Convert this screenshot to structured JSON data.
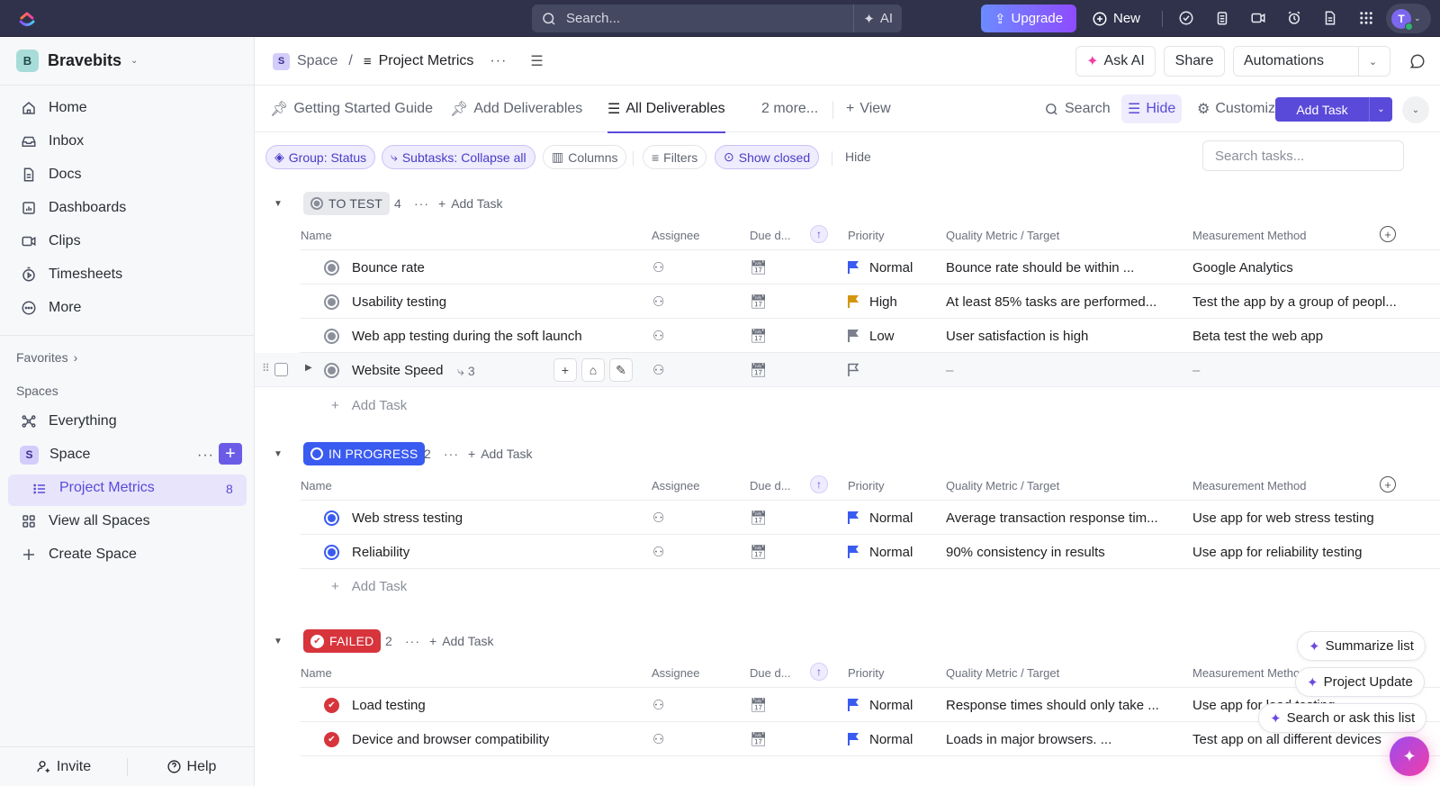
{
  "topbar": {
    "search_placeholder": "Search...",
    "ai_label": "AI",
    "upgrade_label": "Upgrade",
    "new_label": "New",
    "icons": [
      "check-circle-icon",
      "clipboard-icon",
      "video-icon",
      "alarm-clock-icon",
      "document-icon",
      "apps-grid-icon"
    ],
    "avatar_initial": "T"
  },
  "sidebar": {
    "workspace": {
      "initial": "B",
      "name": "Bravebits"
    },
    "nav": [
      {
        "label": "Home",
        "icon": "home-icon"
      },
      {
        "label": "Inbox",
        "icon": "inbox-icon"
      },
      {
        "label": "Docs",
        "icon": "docs-icon"
      },
      {
        "label": "Dashboards",
        "icon": "dashboards-icon"
      },
      {
        "label": "Clips",
        "icon": "clips-icon"
      },
      {
        "label": "Timesheets",
        "icon": "timesheets-icon"
      },
      {
        "label": "More",
        "icon": "more-icon"
      }
    ],
    "favorites_label": "Favorites",
    "spaces_label": "Spaces",
    "everything_label": "Everything",
    "space": {
      "initial": "S",
      "name": "Space"
    },
    "active_list": {
      "label": "Project Metrics",
      "count": "8"
    },
    "view_all_label": "View all Spaces",
    "create_label": "Create Space",
    "invite_label": "Invite",
    "help_label": "Help"
  },
  "header": {
    "breadcrumb": {
      "space_initial": "S",
      "space": "Space",
      "separator": "/",
      "list": "Project Metrics"
    },
    "ask_ai": "Ask AI",
    "share": "Share",
    "automations": "Automations"
  },
  "views": {
    "tabs": [
      {
        "label": "Getting Started Guide",
        "active": false
      },
      {
        "label": "Add Deliverables",
        "active": false
      },
      {
        "label": "All Deliverables",
        "active": true
      },
      {
        "label": "2 more...",
        "active": false
      }
    ],
    "add_view": "View",
    "search": "Search",
    "hide": "Hide",
    "customize": "Customize",
    "add_task": "Add Task"
  },
  "filters": {
    "group": "Group: Status",
    "subtasks": "Subtasks: Collapse all",
    "columns": "Columns",
    "filters": "Filters",
    "show_closed": "Show closed",
    "hide": "Hide",
    "search_placeholder": "Search tasks..."
  },
  "columns": {
    "name": "Name",
    "assignee": "Assignee",
    "due": "Due d...",
    "priority": "Priority",
    "quality": "Quality Metric / Target",
    "method": "Measurement Method"
  },
  "groups": [
    {
      "status": "TO TEST",
      "count": "4",
      "color": "#e8e9ec",
      "add_task": "Add Task",
      "tasks": [
        {
          "name": "Bounce rate",
          "priority": "Normal",
          "flag_color": "#3a5bf0",
          "quality": "Bounce rate should be within ...",
          "method": "Google Analytics"
        },
        {
          "name": "Usability testing",
          "priority": "High",
          "flag_color": "#d4960f",
          "quality": "At least 85% tasks are performed...",
          "method": "Test the app by a group of peopl..."
        },
        {
          "name": "Web app testing during the soft launch",
          "priority": "Low",
          "flag_color": "#7b808c",
          "quality": "User satisfaction is high",
          "method": "Beta test the web app"
        },
        {
          "name": "Website Speed",
          "subtasks": "3",
          "priority": "",
          "flag_color": "",
          "quality": "–",
          "method": "–"
        }
      ]
    },
    {
      "status": "IN PROGRESS",
      "count": "2",
      "color": "#3a5bf0",
      "add_task": "Add Task",
      "tasks": [
        {
          "name": "Web stress testing",
          "priority": "Normal",
          "flag_color": "#3a5bf0",
          "quality": "Average transaction response tim...",
          "method": "Use app for web stress testing"
        },
        {
          "name": "Reliability",
          "priority": "Normal",
          "flag_color": "#3a5bf0",
          "quality": "90% consistency in results",
          "method": "Use app for reliability testing"
        }
      ]
    },
    {
      "status": "FAILED",
      "count": "2",
      "color": "#d7343c",
      "add_task": "Add Task",
      "tasks": [
        {
          "name": "Load testing",
          "priority": "Normal",
          "flag_color": "#3a5bf0",
          "quality": "Response times should only take ...",
          "method": "Use app for load testing"
        },
        {
          "name": "Device and browser compatibility",
          "priority": "Normal",
          "flag_color": "#3a5bf0",
          "quality": "Loads in major browsers. ...",
          "method": "Test app on all different devices"
        }
      ]
    }
  ],
  "add_task_row": "Add Task",
  "ai_suggestions": [
    "Summarize list",
    "Project Update",
    "Search or ask this list"
  ]
}
